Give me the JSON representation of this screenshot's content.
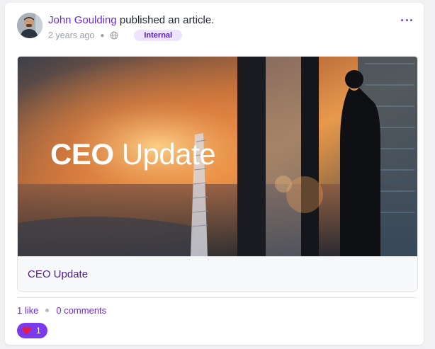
{
  "post": {
    "author": "John Goulding",
    "action": "published an article.",
    "time": "2 years ago",
    "visibility_badge": "Internal",
    "icons": {
      "menu": "more-horizontal-icon",
      "visibility": "globe-icon",
      "reaction": "heart-icon"
    }
  },
  "article": {
    "hero_title_bold": "CEO",
    "hero_title_light": "Update",
    "title": "CEO Update"
  },
  "engagement": {
    "likes_label": "1 like",
    "comments_label": "0 comments",
    "reaction_count": "1"
  },
  "colors": {
    "accent": "#7c3aed",
    "link": "#6c2bd9",
    "badge_bg": "#eee4ff"
  }
}
